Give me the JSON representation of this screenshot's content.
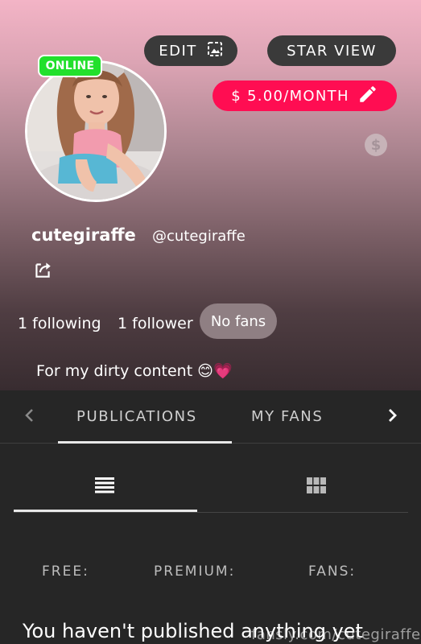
{
  "header": {
    "edit_label": "EDIT",
    "star_view_label": "STAR VIEW",
    "price_label": "$ 5.00/MONTH",
    "online_badge": "ONLINE"
  },
  "profile": {
    "display_name": "cutegiraffe",
    "handle": "@cutegiraffe",
    "following": "1 following",
    "followers": "1 follower",
    "fans_chip": "No fans",
    "bio": "For my dirty content 😊💗"
  },
  "tabs": {
    "items": [
      "PUBLICATIONS",
      "MY FANS"
    ],
    "active": "PUBLICATIONS"
  },
  "content": {
    "free_label": "FREE:",
    "premium_label": "PREMIUM:",
    "fans_label": "FANS:",
    "empty_message": "You haven't published anything yet"
  },
  "watermark": "fansly.com/cutegiraffe",
  "colors": {
    "accent": "#ff0d52",
    "online": "#22e02c",
    "dark_bg": "#262626",
    "pill_bg": "#3a3a3a"
  },
  "icons": {
    "edit": "image-edit-icon",
    "price": "pencil-icon",
    "share": "share-icon",
    "dollar": "dollar-circle-icon",
    "list_view": "list-view-icon",
    "grid_view": "grid-view-icon"
  }
}
